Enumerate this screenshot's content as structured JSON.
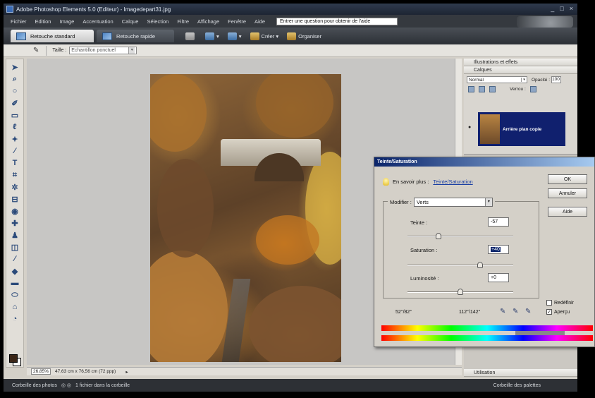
{
  "window": {
    "title": "Adobe Photoshop Elements 5.0 (Editeur) - Imagedepart31.jpg",
    "controls": [
      "_",
      "□",
      "×"
    ]
  },
  "menu": {
    "items": [
      "Fichier",
      "Edition",
      "Image",
      "Accentuation",
      "Calque",
      "Sélection",
      "Filtre",
      "Affichage",
      "Fenêtre",
      "Aide"
    ],
    "help_placeholder": "Entrer une question pour obtenir de l'aide"
  },
  "shortcuts": {
    "tab_standard": "Retouche standard",
    "tab_quick": "Retouche rapide",
    "create": "Créer",
    "organize": "Organiser"
  },
  "options": {
    "size_label": "Taille :",
    "size_value": "Echantillon ponctuel"
  },
  "document": {
    "zoom": "26,85%",
    "dimensions": "47,63 cm x 76,56 cm (72 ppp)"
  },
  "status": {
    "left": "Corbeille des photos",
    "middle": "1 fichier dans la corbeille",
    "right": "Corbeille des palettes"
  },
  "palettes": {
    "illustrations": "Illustrations et effets",
    "layers": "Calques",
    "blend_mode": "Normal",
    "opacity_label": "Opacité :",
    "opacity_value": "100",
    "lock_label": "Verrou :",
    "layer_name": "Arrière plan copie",
    "utilisation": "Utilisation"
  },
  "dialog": {
    "title": "Teinte/Saturation",
    "learn_more": "En savoir plus :",
    "learn_link": "Teinte/Saturation",
    "ok": "OK",
    "cancel": "Annuler",
    "help": "Aide",
    "edit_label": "Modifier :",
    "edit_value": "Verts",
    "hue_label": "Teinte :",
    "hue_value": "-57",
    "saturation_label": "Saturation :",
    "saturation_value": "+40",
    "lightness_label": "Luminosité :",
    "lightness_value": "+0",
    "colorize_label": "Redéfinir",
    "preview_label": "Aperçu",
    "range_left": "52°/82°",
    "range_right": "112°\\142°",
    "hue_level": 0.28,
    "saturation_level": 0.7,
    "lightness_level": 0.5,
    "preview_checked": true,
    "colorize_checked": false
  },
  "colors": {
    "foreground": "#3a2516",
    "background": "#ffffff",
    "dialog_title": "#0a246a",
    "selected_layer": "#10206e"
  }
}
